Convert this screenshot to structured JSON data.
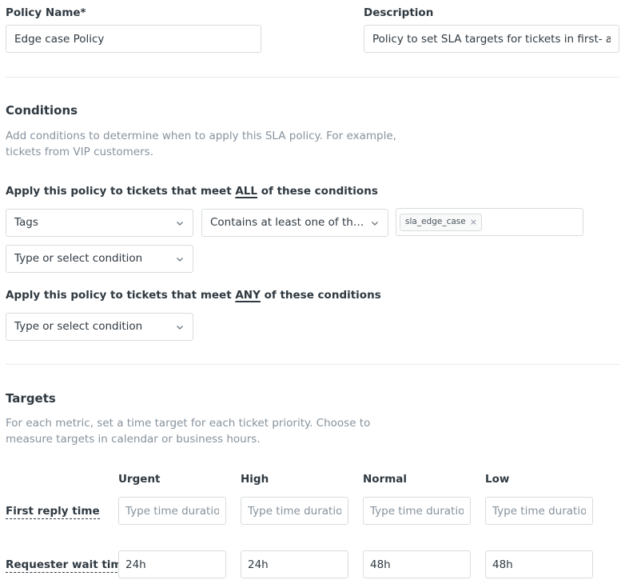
{
  "policy": {
    "name_label": "Policy Name*",
    "name_value": "Edge case Policy",
    "description_label": "Description",
    "description_value": "Policy to set SLA targets for tickets in first- and next-level support"
  },
  "conditions": {
    "title": "Conditions",
    "help_line1": "Add conditions to determine when to apply this SLA policy. For example,",
    "help_line2": "tickets from VIP customers.",
    "all_prefix": "Apply this policy to tickets that meet ",
    "all_keyword": "ALL",
    "all_suffix": " of these conditions",
    "all_rows": [
      {
        "field": "Tags",
        "operator": "Contains at least one of the fol...",
        "tags": [
          "sla_edge_case"
        ]
      }
    ],
    "select_placeholder": "Type or select condition",
    "any_prefix": "Apply this policy to tickets that meet ",
    "any_keyword": "ANY",
    "any_suffix": " of these conditions"
  },
  "targets": {
    "title": "Targets",
    "help_line1": "For each metric, set a time target for each ticket priority. Choose to",
    "help_line2": "measure targets in calendar or business hours.",
    "priorities": [
      "Urgent",
      "High",
      "Normal",
      "Low"
    ],
    "placeholder": "Type time duration",
    "metrics": [
      {
        "label": "First reply time",
        "values": [
          "",
          "",
          "",
          ""
        ]
      },
      {
        "label": "Requester wait time",
        "values": [
          "24h",
          "24h",
          "48h",
          "48h"
        ]
      }
    ]
  },
  "icons": {
    "chevron": "chevron-down-icon",
    "remove": "close-icon"
  }
}
